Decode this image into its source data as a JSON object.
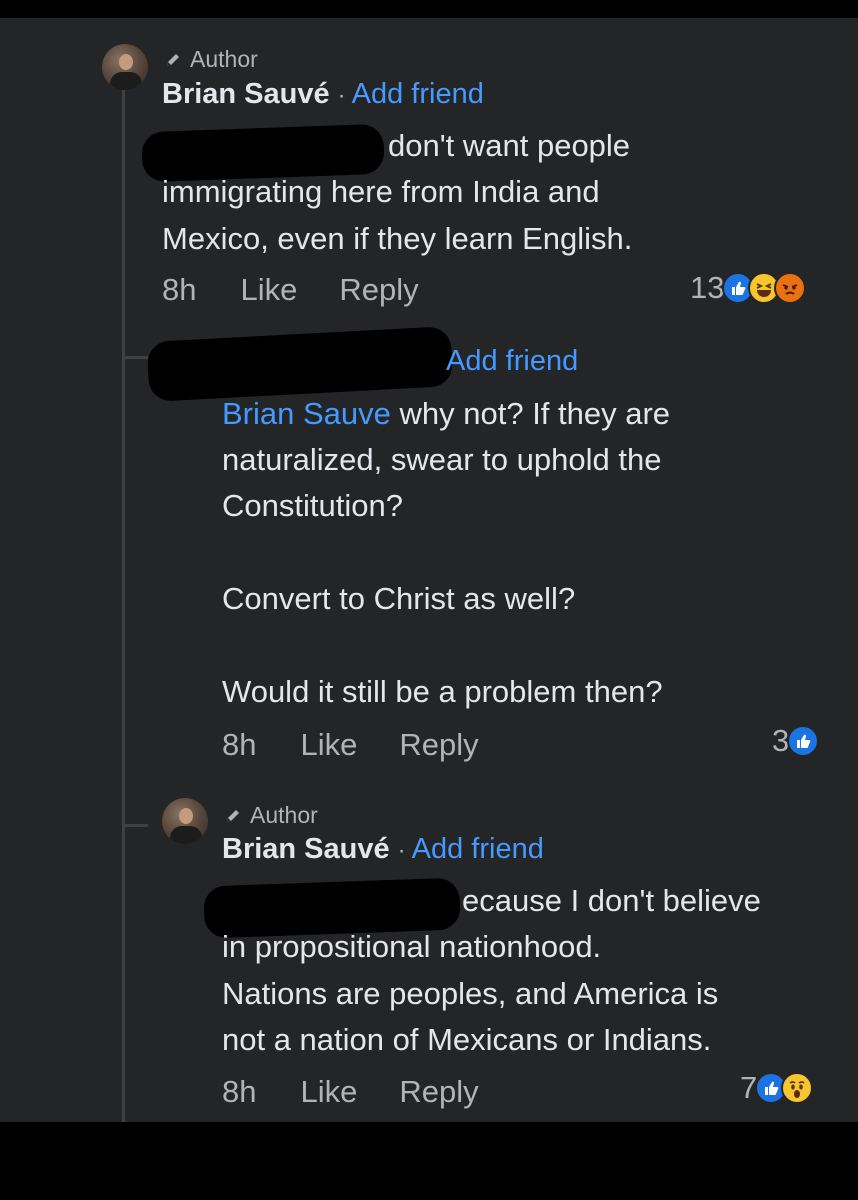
{
  "comments": [
    {
      "author_badge": "Author",
      "name": "Brian Sauvé",
      "separator": "·",
      "add_friend": "Add friend",
      "lines": [
        "don't want people",
        "immigrating here from India and",
        "Mexico, even if they learn English."
      ],
      "time": "8h",
      "like": "Like",
      "reply": "Reply",
      "reaction_count": "13",
      "reaction_icons": [
        "like-icon",
        "haha-icon",
        "angry-icon"
      ]
    },
    {
      "add_friend": "Add friend",
      "mention": "Brian Sauve",
      "lines": [
        " why not? If they are",
        "naturalized, swear to uphold the",
        "Constitution?",
        "",
        "Convert to Christ as well?",
        "",
        "Would it still be a problem then?"
      ],
      "time": "8h",
      "like": "Like",
      "reply": "Reply",
      "reaction_count": "3",
      "reaction_icons": [
        "like-icon"
      ]
    },
    {
      "author_badge": "Author",
      "name": "Brian Sauvé",
      "separator": "·",
      "add_friend": "Add friend",
      "lines": [
        "ecause I don't believe",
        "in propositional nationhood.",
        "Nations are peoples, and America is",
        "not a nation of Mexicans or Indians."
      ],
      "time": "8h",
      "like": "Like",
      "reply": "Reply",
      "reaction_count": "7",
      "reaction_icons": [
        "like-icon",
        "wow-icon"
      ]
    }
  ],
  "colors": {
    "background": "#242526",
    "text": "#e4e6eb",
    "secondary_text": "#b0b3b8",
    "link": "#4599ff",
    "like_blue": "#1b74e4"
  }
}
